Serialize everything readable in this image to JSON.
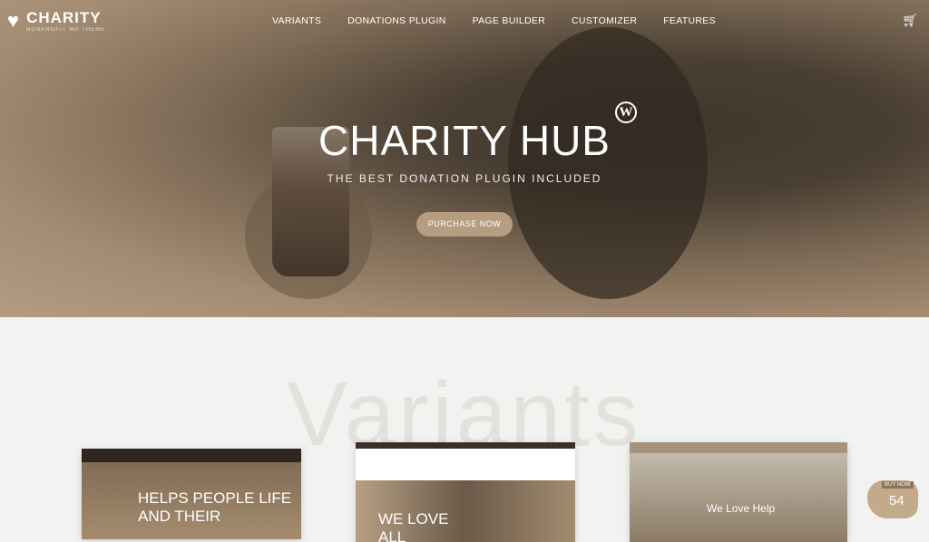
{
  "nav": {
    "logo_title": "CHARITY",
    "logo_sub": "NONPROFIT WP THEME",
    "items": [
      "VARIANTS",
      "DONATIONS PLUGIN",
      "PAGE BUILDER",
      "CUSTOMIZER",
      "FEATURES"
    ]
  },
  "hero": {
    "title": "CHARITY HUB",
    "wp": "W",
    "subtitle": "THE BEST DONATION PLUGIN INCLUDED",
    "button": "PURCHASE NOW"
  },
  "variants": {
    "heading": "Variants",
    "cards": [
      "HELPS PEOPLE LIFE AND THEIR",
      "WE LOVE ALL PEOPLE",
      "We Love Help"
    ]
  },
  "badge": {
    "label": "BUY NOW",
    "count": "54"
  }
}
